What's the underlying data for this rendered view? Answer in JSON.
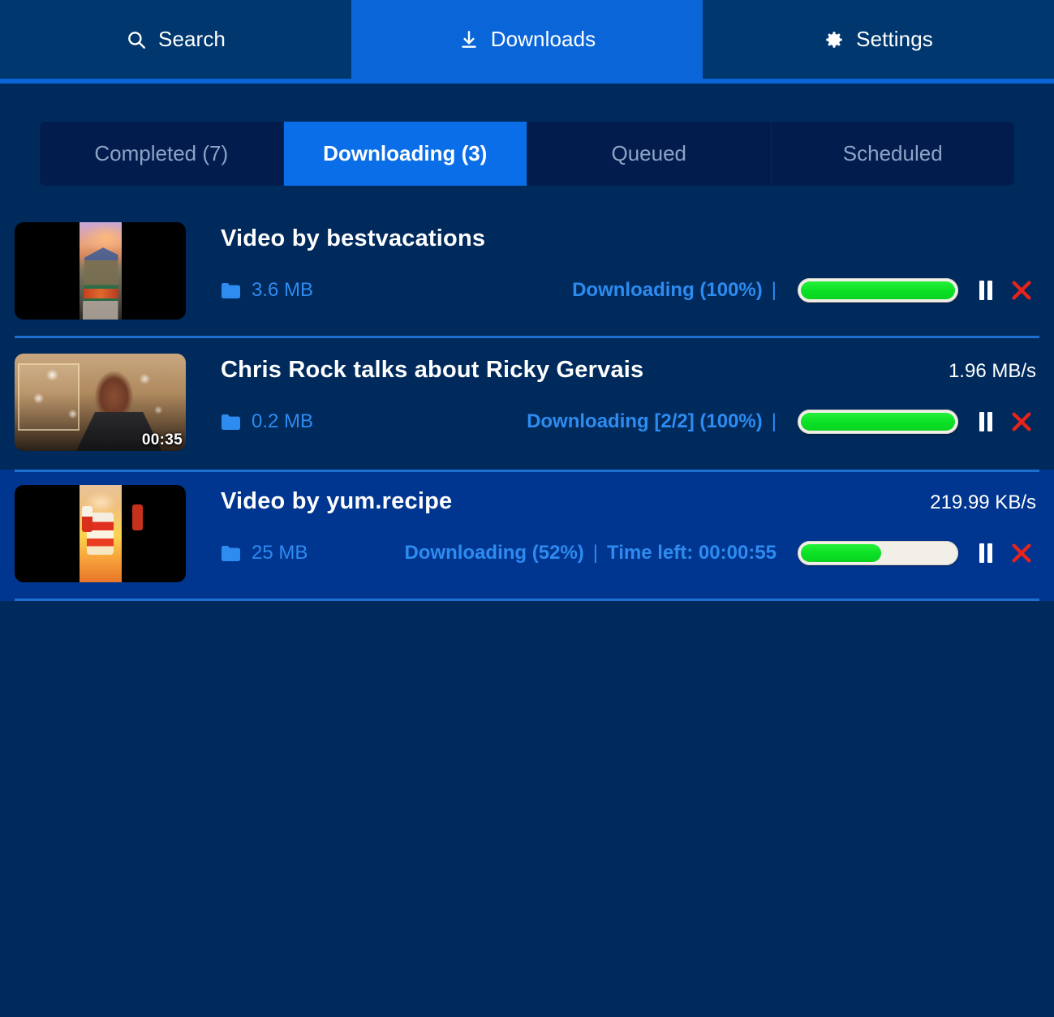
{
  "colors": {
    "page_bg": "#002a5c",
    "nav_bg": "#00376e",
    "accent_blue": "#0a66d8",
    "seg_bg": "#021d4d",
    "seg_active": "#0a6ee8",
    "row_selected": "#00368f",
    "separator": "#1f6fd0",
    "link_blue": "#2e8bf0",
    "progress_green": "#0ae024",
    "cancel_red": "#e8231c",
    "text_white": "#ffffff",
    "text_muted": "#8ba4c6"
  },
  "nav": {
    "tabs": [
      {
        "label": "Search",
        "icon": "search-icon",
        "active": false
      },
      {
        "label": "Downloads",
        "icon": "download-icon",
        "active": true
      },
      {
        "label": "Settings",
        "icon": "gear-icon",
        "active": false
      }
    ]
  },
  "segmented_tabs": [
    {
      "label": "Completed (7)",
      "active": false
    },
    {
      "label": "Downloading (3)",
      "active": true
    },
    {
      "label": "Queued",
      "active": false
    },
    {
      "label": "Scheduled",
      "active": false
    }
  ],
  "downloads": [
    {
      "title": "Video by bestvacations",
      "size": "3.6 MB",
      "status": "Downloading (100%)",
      "divider": "|",
      "extra": "",
      "speed": "",
      "progress_percent": 100,
      "duration": "",
      "selected": false,
      "thumb_style": "art-city",
      "thumb_layout": "portrait",
      "pause_label": "pause-button",
      "cancel_label": "cancel-button"
    },
    {
      "title": "Chris Rock talks about Ricky Gervais",
      "size": "0.2 MB",
      "status": "Downloading [2/2] (100%)",
      "divider": "|",
      "extra": "",
      "speed": "1.96 MB/s",
      "progress_percent": 100,
      "duration": "00:35",
      "selected": false,
      "thumb_style": "art-rock",
      "thumb_layout": "full",
      "pause_label": "pause-button",
      "cancel_label": "cancel-button"
    },
    {
      "title": "Video by yum.recipe",
      "size": "25 MB",
      "status": "Downloading (52%)",
      "divider": "|",
      "extra": "Time left: 00:00:55",
      "speed": "219.99 KB/s",
      "progress_percent": 52,
      "duration": "",
      "selected": true,
      "thumb_style": "art-dessert",
      "thumb_layout": "portrait",
      "pause_label": "pause-button",
      "cancel_label": "cancel-button"
    }
  ]
}
